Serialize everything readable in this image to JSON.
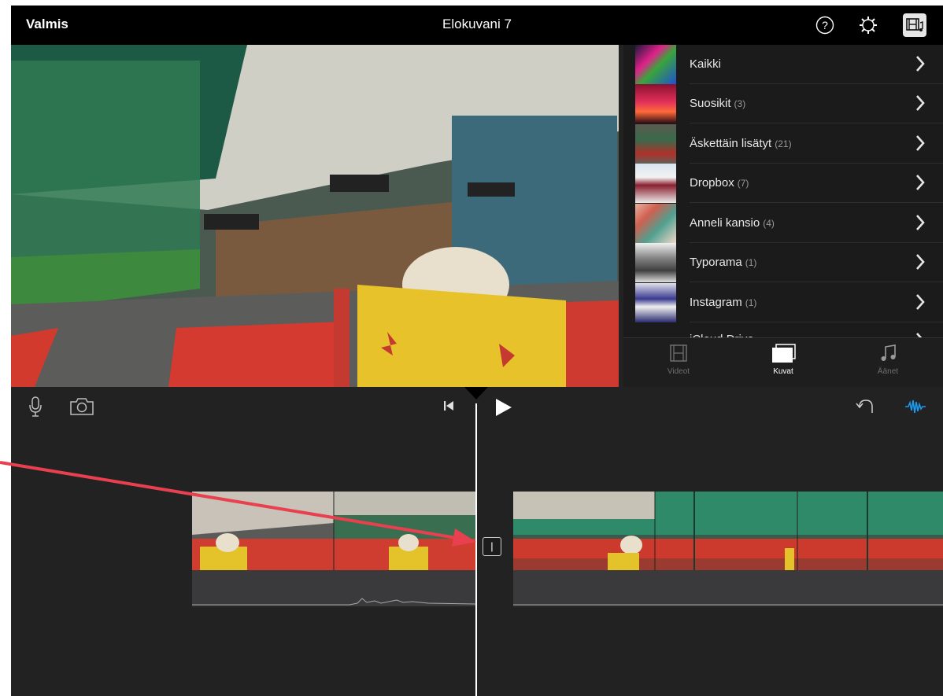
{
  "window": {
    "title": "Elokuvani 7"
  },
  "topbar": {
    "done_label": "Valmis",
    "help_icon": "help-icon",
    "settings_icon": "gear-icon",
    "media_icon": "film-library-icon"
  },
  "albums": [
    {
      "name": "Kaikki",
      "count": ""
    },
    {
      "name": "Suosikit",
      "count": "(3)"
    },
    {
      "name": "Äskettäin lisätyt",
      "count": "(21)"
    },
    {
      "name": "Dropbox",
      "count": "(7)"
    },
    {
      "name": "Anneli kansio",
      "count": "(4)"
    },
    {
      "name": "Typorama",
      "count": "(1)"
    },
    {
      "name": "Instagram",
      "count": "(1)"
    },
    {
      "name": "iCloud Drive",
      "count": ""
    }
  ],
  "media_tabs": [
    {
      "label": "Videot",
      "icon": "film-icon",
      "active": false
    },
    {
      "label": "Kuvat",
      "icon": "photos-icon",
      "active": true
    },
    {
      "label": "Äänet",
      "icon": "music-note-icon",
      "active": false
    }
  ],
  "timeline_toolbar": {
    "mic_icon": "microphone-icon",
    "camera_icon": "camera-icon",
    "rewind_icon": "skip-back-icon",
    "play_icon": "play-icon",
    "undo_icon": "undo-icon",
    "waveform_icon": "waveform-icon"
  },
  "timeline": {
    "transition_label": "|"
  },
  "colors": {
    "accent": "#1a9bf0",
    "annotation_arrow": "#e8404f",
    "background": "#222223"
  }
}
